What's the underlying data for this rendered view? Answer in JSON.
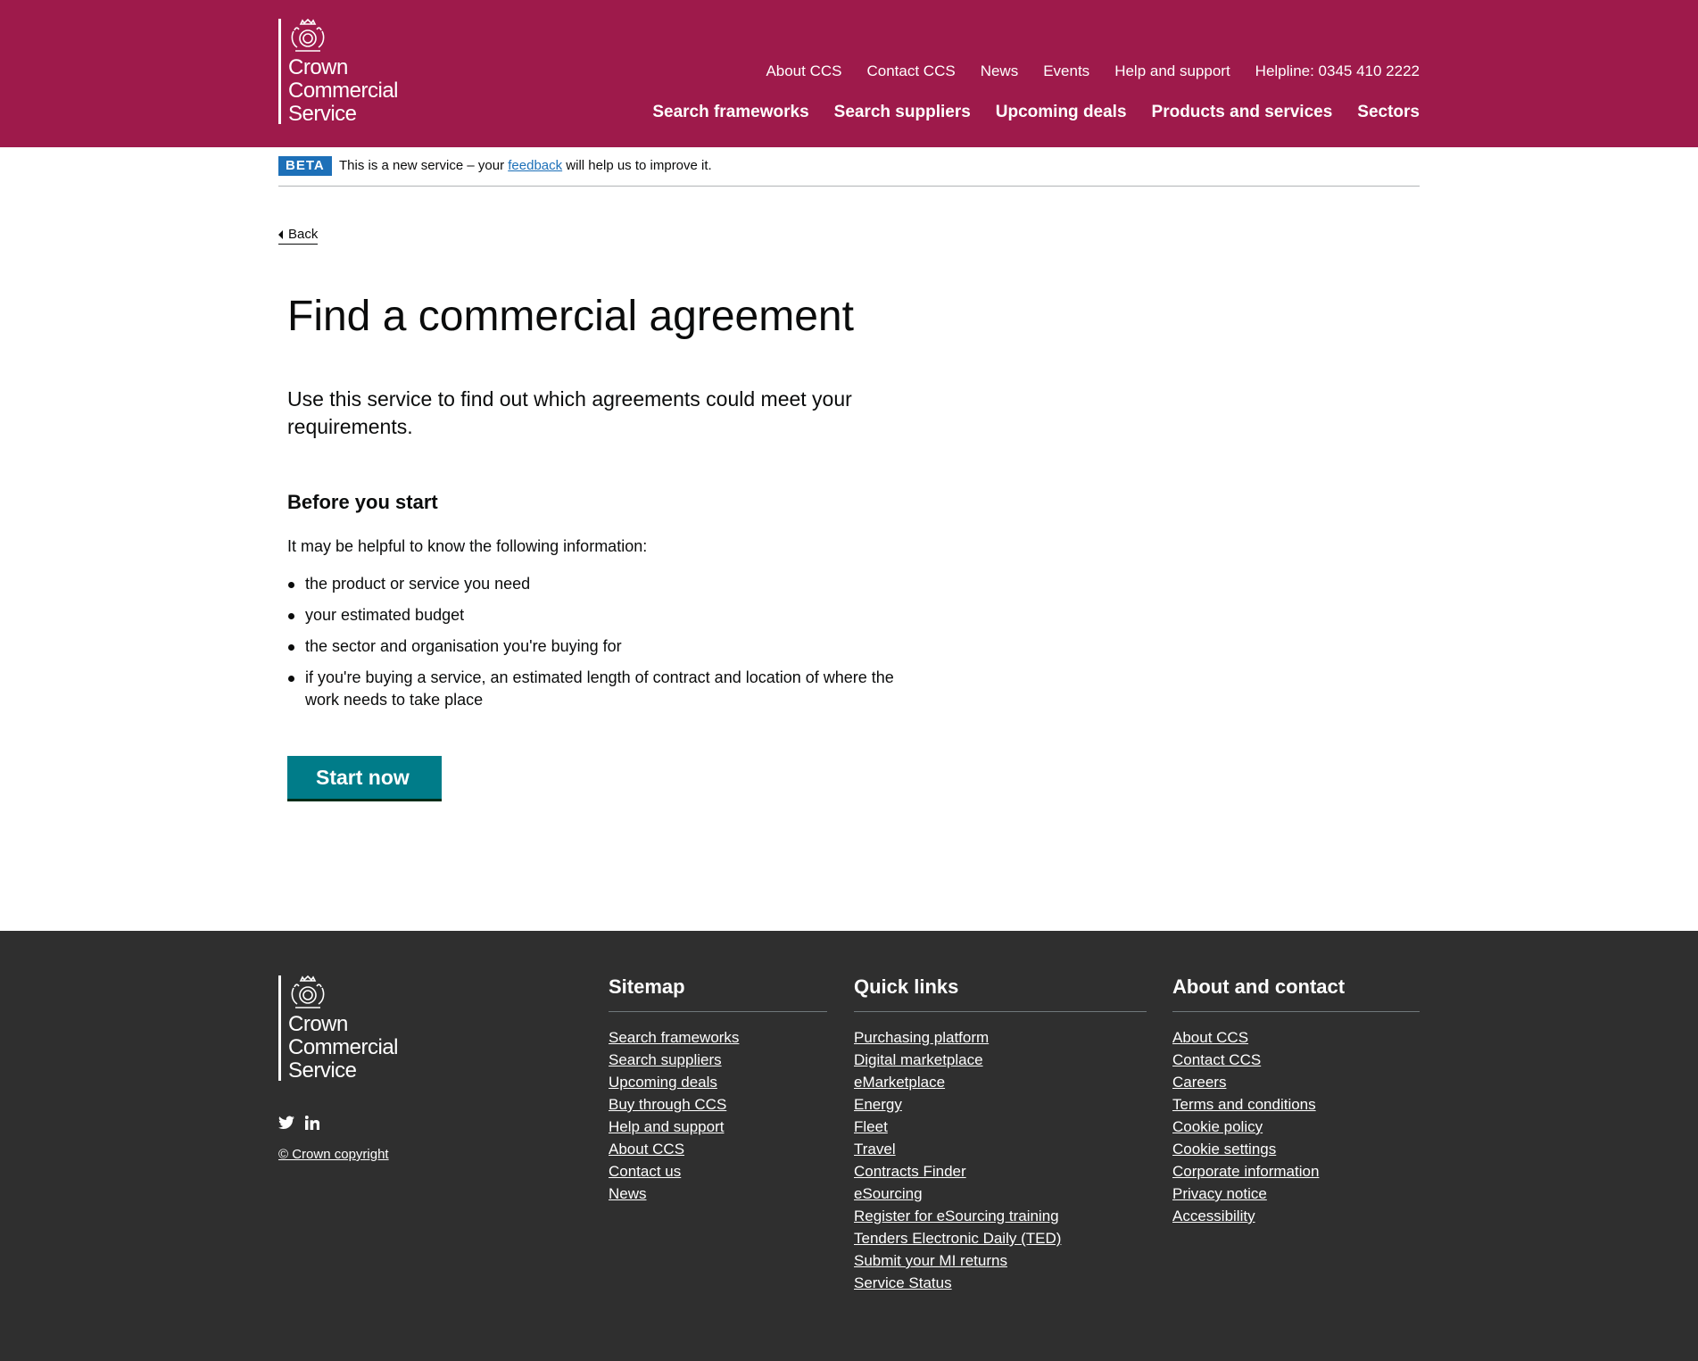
{
  "header": {
    "logo_lines": [
      "Crown",
      "Commercial",
      "Service"
    ],
    "utility_nav": [
      "About CCS",
      "Contact CCS",
      "News",
      "Events",
      "Help and support",
      "Helpline: 0345 410 2222"
    ],
    "main_nav": [
      "Search frameworks",
      "Search suppliers",
      "Upcoming deals",
      "Products and services",
      "Sectors"
    ]
  },
  "beta": {
    "tag": "BETA",
    "text_before": "This is a new service – your ",
    "link": "feedback",
    "text_after": " will help us to improve it."
  },
  "back_label": "Back",
  "main": {
    "title": "Find a commercial agreement",
    "lead": "Use this service to find out which agreements could meet your requirements.",
    "before_heading": "Before you start",
    "intro": "It may be helpful to know the following information:",
    "items": [
      "the product or service you need",
      "your estimated budget",
      "the sector and organisation you're buying for",
      "if you're buying a service, an estimated length of contract and location of where the work needs to take place"
    ],
    "start_label": "Start now"
  },
  "footer": {
    "copyright": "© Crown copyright",
    "sitemap": {
      "title": "Sitemap",
      "links": [
        "Search frameworks",
        "Search suppliers",
        "Upcoming deals",
        "Buy through CCS",
        "Help and support",
        "About CCS",
        "Contact us",
        "News"
      ]
    },
    "quick_links": {
      "title": "Quick links",
      "links": [
        "Purchasing platform",
        "Digital marketplace",
        "eMarketplace",
        "Energy",
        "Fleet",
        "Travel",
        "Contracts Finder",
        "eSourcing",
        "Register for eSourcing training",
        "Tenders Electronic Daily (TED)",
        "Submit your MI returns",
        "Service Status"
      ]
    },
    "about": {
      "title": "About and contact",
      "links": [
        "About CCS",
        "Contact CCS",
        "Careers",
        "Terms and conditions",
        "Cookie policy",
        "Cookie settings",
        "Corporate information",
        "Privacy notice",
        "Accessibility"
      ]
    }
  },
  "colors": {
    "header_bg": "#9e1a4b",
    "beta_tag": "#1d70b8",
    "start_button": "#007c89",
    "footer_bg": "#2f2f2f"
  }
}
